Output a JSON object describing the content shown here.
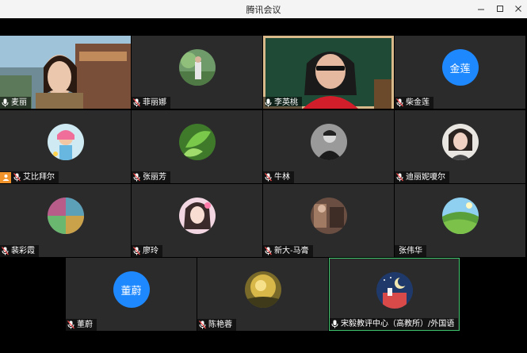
{
  "window": {
    "title": "腾讯会议",
    "minimize_icon": "minimize-icon",
    "maximize_icon": "maximize-icon",
    "close_icon": "close-icon"
  },
  "participants": [
    {
      "name": "麦丽",
      "video": true,
      "mic": "on"
    },
    {
      "name": "菲丽娜",
      "video": false,
      "mic": "muted"
    },
    {
      "name": "李英桃",
      "video": true,
      "mic": "on"
    },
    {
      "name": "柴金莲",
      "video": false,
      "mic": "muted",
      "avatar_text": "金莲"
    },
    {
      "name": "艾比拜尔",
      "video": false,
      "mic": "muted",
      "host": true
    },
    {
      "name": "张丽芳",
      "video": false,
      "mic": "muted"
    },
    {
      "name": "牛林",
      "video": false,
      "mic": "muted"
    },
    {
      "name": "迪丽妮嗄尔",
      "video": false,
      "mic": "muted"
    },
    {
      "name": "裴彩霞",
      "video": false,
      "mic": "muted"
    },
    {
      "name": "廖玲",
      "video": false,
      "mic": "muted"
    },
    {
      "name": "新大-马膏",
      "video": false,
      "mic": "muted"
    },
    {
      "name": "张伟华",
      "video": false,
      "mic": "none"
    },
    {
      "name": "董蔚",
      "video": false,
      "mic": "muted",
      "avatar_text": "董蔚"
    },
    {
      "name": "陈艳蓉",
      "video": false,
      "mic": "muted"
    },
    {
      "name": "宋毅教评中心（高教所）/外国语",
      "video": false,
      "mic": "on",
      "active_speaker": true
    }
  ],
  "colors": {
    "tile_bg": "#2b2b2b",
    "text_avatar": "#1e88ff",
    "active_border": "#3ec46d",
    "host_badge": "#f0932b"
  }
}
